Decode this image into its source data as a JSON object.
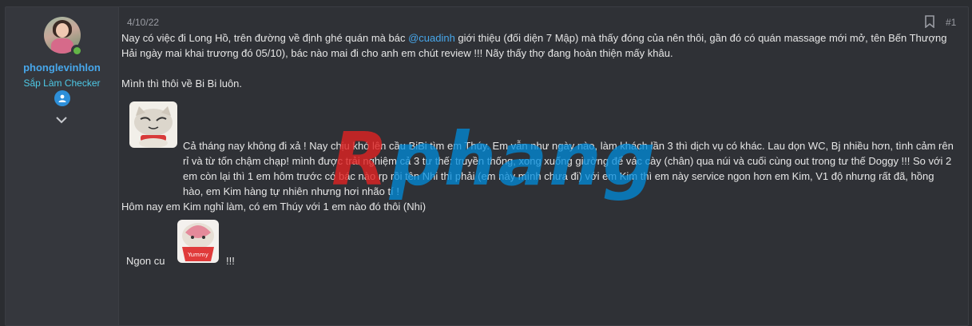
{
  "user": {
    "username": "phonglevinhlon",
    "title": "Sắp Làm Checker"
  },
  "post": {
    "date": "4/10/22",
    "number": "#1",
    "para1_before": "Nay có việc đi Long Hồ, trên đường về định ghé quán mà bác ",
    "para1_mention": "@cuadinh",
    "para1_after": " giới thiệu (đối diện 7 Mập) mà thấy đóng của nên thôi, gần đó có quán massage mới mở, tên Bến Thượng Hải ngày mai khai trương đó 05/10), bác nào mai đi cho anh em chút review !!! Nãy thấy thợ đang hoàn thiện mấy khâu.",
    "para2": "Mình thì thôi về Bi Bi luôn.",
    "para3": "Cả tháng nay không đi xả ! Nay chịu khó lên cầu BiBi tìm em Thúy. Em vẫn như ngày nào, làm khách lần 3 thì dịch vụ có khác. Lau dọn WC, Bj nhiều hơn, tình cảm rên rỉ và từ tốn chậm chạp! mình được trải nghiệm cả 3 tư thế: truyền thống, xong xuống giường để vác cày (chân) qua núi và cuối cùng out trong tư thế Doggy !!! So với 2 em còn lại thì 1 em hôm trước có bác nào rp rồi tên Nhi thì phải (em này mình chưa đi) với em Kim thì em này service ngon hơn em Kim, V1 độ nhưng rất đã, hồng hào, em Kim hàng tự nhiên nhưng hơi nhão tí !",
    "para4": "Hôm nay em Kim nghỉ làm, có em Thúy với 1 em nào đó thôi (Nhi)",
    "para5_before": "Ngon cu",
    "para5_after": "!!!"
  },
  "stickers": {
    "sticker2_text": "Yummy"
  },
  "watermark": {
    "part1": "R",
    "part2": "phang"
  },
  "colors": {
    "background": "#2b2d31",
    "username": "#47a7eb",
    "usertitle": "#4ec9e6",
    "mention": "#47a7eb",
    "online": "#63b547"
  }
}
